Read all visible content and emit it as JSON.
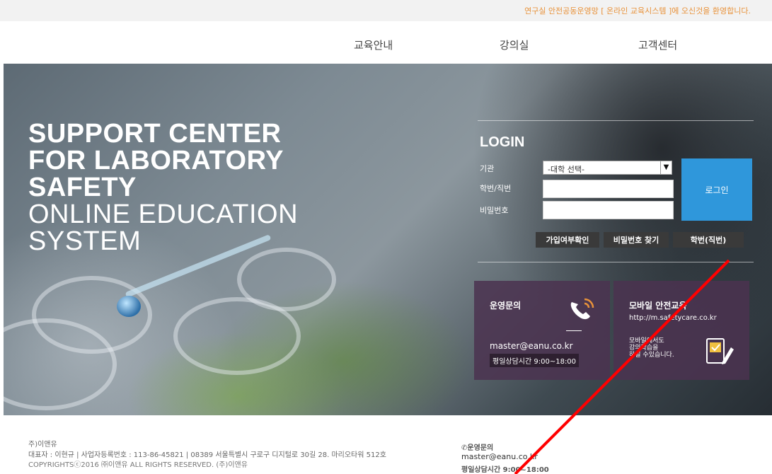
{
  "topbar": {
    "message": "연구실 안전공동운영망 [ 온라인 교육시스템 ]에 오신것을 환영합니다."
  },
  "nav": {
    "items": [
      {
        "label": "교육안내"
      },
      {
        "label": "강의실"
      },
      {
        "label": "고객센터"
      }
    ]
  },
  "hero": {
    "title_line1": "SUPPORT CENTER",
    "title_line2": "FOR LABORATORY",
    "title_line3": "SAFETY",
    "title_line4": "ONLINE EDUCATION",
    "title_line5": "SYSTEM"
  },
  "login": {
    "title": "LOGIN",
    "institution_label": "기관",
    "institution_selected": "-대학 선택-",
    "id_label": "학번/직번",
    "id_value": "",
    "password_label": "비밀번호",
    "password_value": "",
    "login_button": "로그인",
    "check_signup_button": "가입여부확인",
    "find_password_button": "비밀번호 찾기",
    "find_id_button": "학번(직번)"
  },
  "contact_box": {
    "title": "운영문의",
    "email": "master@eanu.co.kr",
    "hours": "평일상담시간 9:00~18:00"
  },
  "mobile_box": {
    "title": "모바일 안전교육",
    "url": "http://m.safetycare.co.kr",
    "desc_line1": "모바일에서도",
    "desc_line2": "강의학습을",
    "desc_line3": "하실 수있습니다."
  },
  "footer": {
    "company": "주)이앤유",
    "business_info": "대표자 : 이현규  |  사업자등록번호 : 113-86-45821  |  08389 서울특별시 구로구 디지털로 30길 28. 마리오타워 512호",
    "copyright": "COPYRIGHTSⓒ2016 ㈜이앤유 ALL RIGHTS RESERVED. (주)이앤유",
    "contact_title": "운영문의",
    "contact_email": "master@eanu.co.kr",
    "contact_hours": "평일상담시간 9:00~18:00"
  },
  "colors": {
    "accent_orange": "#e8923a",
    "login_blue": "#2f97db",
    "info_box_purple": "#4b3250",
    "annotation_red": "#ff0000"
  },
  "icons": [
    "phone-icon",
    "mobile-check-icon",
    "footer-phone-icon",
    "chevron-down-icon"
  ]
}
